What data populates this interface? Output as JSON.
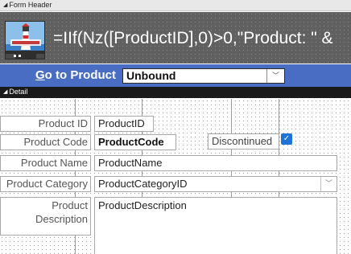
{
  "sections": {
    "form_header": "Form Header",
    "detail": "Detail"
  },
  "header": {
    "logo_icon": "lighthouse-logo-icon",
    "formula": "=IIf(Nz([ProductID],0)>0,\"Product: \" & "
  },
  "goto": {
    "label_underlined": "G",
    "label_rest": "o to Product",
    "combo_value": "Unbound",
    "combo_icon": "chevron-down-icon"
  },
  "fields": {
    "product_id": {
      "label": "Product ID",
      "control": "ProductID"
    },
    "product_code": {
      "label": "Product Code",
      "control": "ProductCode"
    },
    "discontinued": {
      "label": "Discontinued",
      "checked": true
    },
    "product_name": {
      "label": "Product Name",
      "control": "ProductName"
    },
    "product_category": {
      "label": "Product Category",
      "control": "ProductCategoryID"
    },
    "product_description": {
      "label_line1": "Product",
      "label_line2": "Description",
      "control": "ProductDescription"
    }
  },
  "colors": {
    "goto_bar": "#4a6dc4",
    "header_bg": "#606060",
    "detail_bar": "#1a1a1a",
    "checkbox": "#1e73d8"
  }
}
